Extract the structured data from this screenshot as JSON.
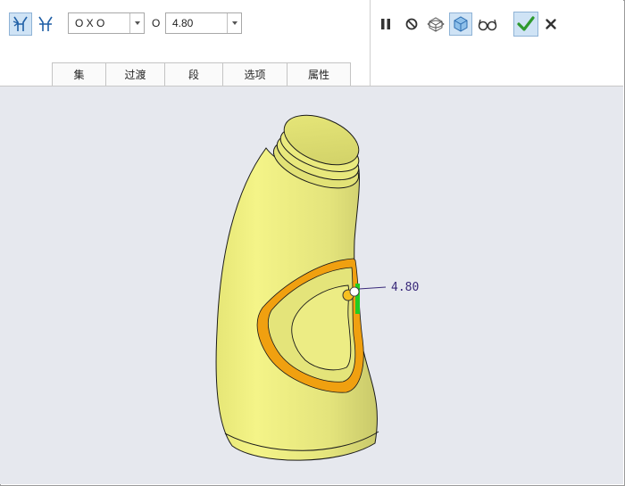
{
  "toolbar": {
    "tools": [
      {
        "name": "chain-one-direction-icon",
        "active": true
      },
      {
        "name": "chain-both-direction-icon",
        "active": false
      }
    ],
    "chain_combo": {
      "value": "O X O"
    },
    "value_prefix": "O",
    "thickness_combo": {
      "value": "4.80"
    },
    "tabs": [
      {
        "label": "集"
      },
      {
        "label": "过渡"
      },
      {
        "label": "段"
      },
      {
        "label": "选项"
      },
      {
        "label": "属性"
      }
    ],
    "actions": [
      {
        "name": "pause-icon"
      },
      {
        "name": "no-preview-icon"
      },
      {
        "name": "preview-icon"
      },
      {
        "name": "verify-preview-icon"
      },
      {
        "name": "view-glasses-icon"
      },
      {
        "name": "ok-check-icon"
      },
      {
        "name": "cancel-x-icon"
      }
    ]
  },
  "viewport": {
    "dimension_label": "4.80",
    "colors": {
      "background": "#e6e8ee",
      "body": "#e6e67a",
      "selection": "#f0a010",
      "handle": "#22cc22",
      "edge": "#1a1a1a"
    }
  }
}
